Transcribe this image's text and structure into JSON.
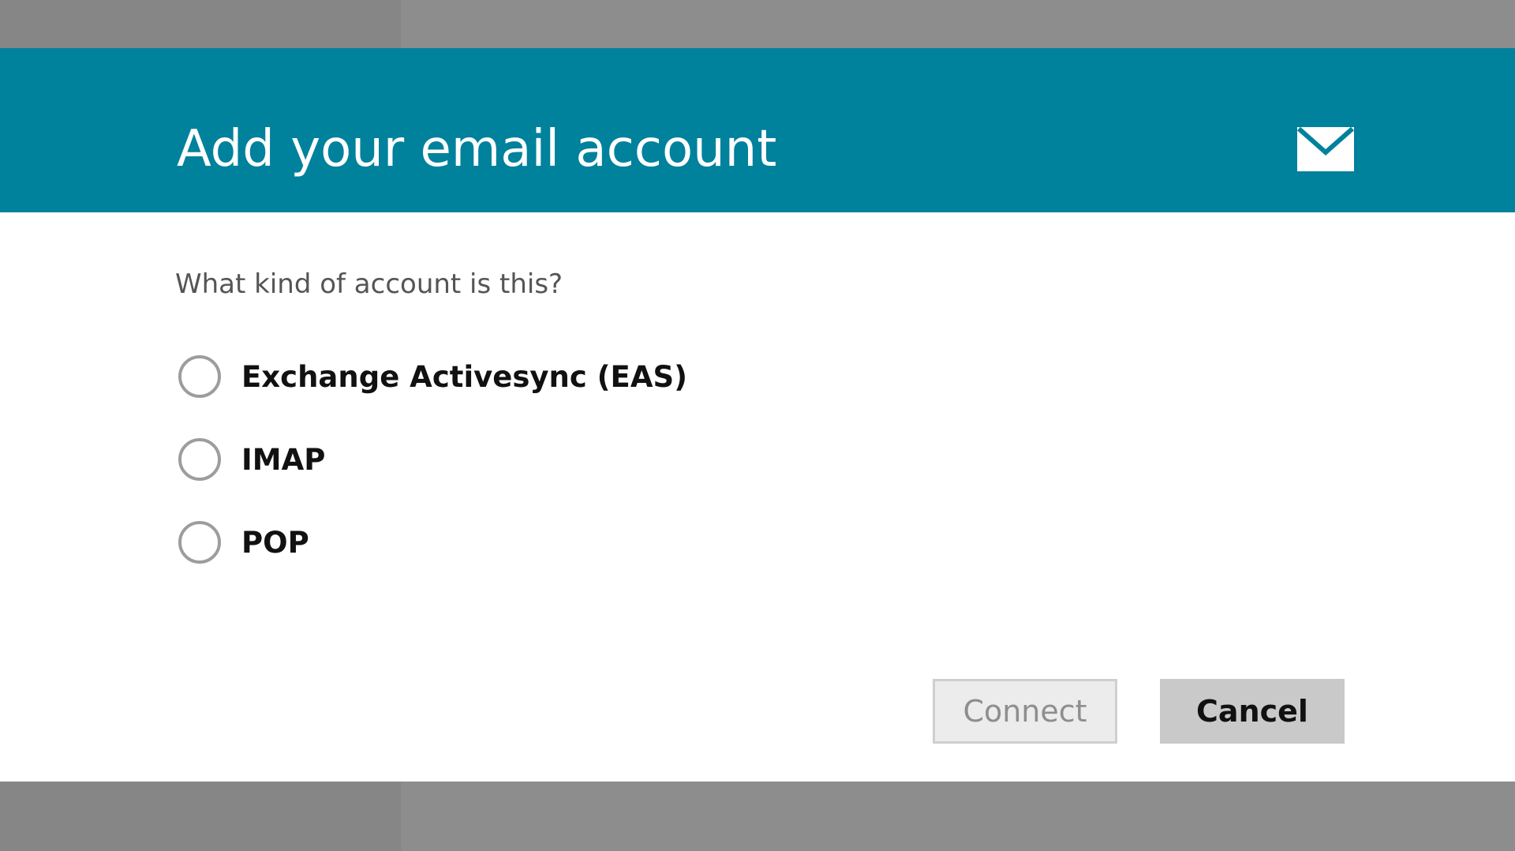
{
  "dialog": {
    "title": "Add your email account",
    "header_icon": "envelope-icon",
    "question": "What kind of account is this?",
    "options": [
      {
        "label": "Exchange Activesync (EAS)",
        "selected": false
      },
      {
        "label": "IMAP",
        "selected": false
      },
      {
        "label": "POP",
        "selected": false
      }
    ],
    "buttons": {
      "connect_label": "Connect",
      "connect_enabled": false,
      "cancel_label": "Cancel"
    }
  },
  "colors": {
    "header_background": "#00819c",
    "overlay_background": "#8c8c8c",
    "dialog_background": "#ffffff"
  }
}
